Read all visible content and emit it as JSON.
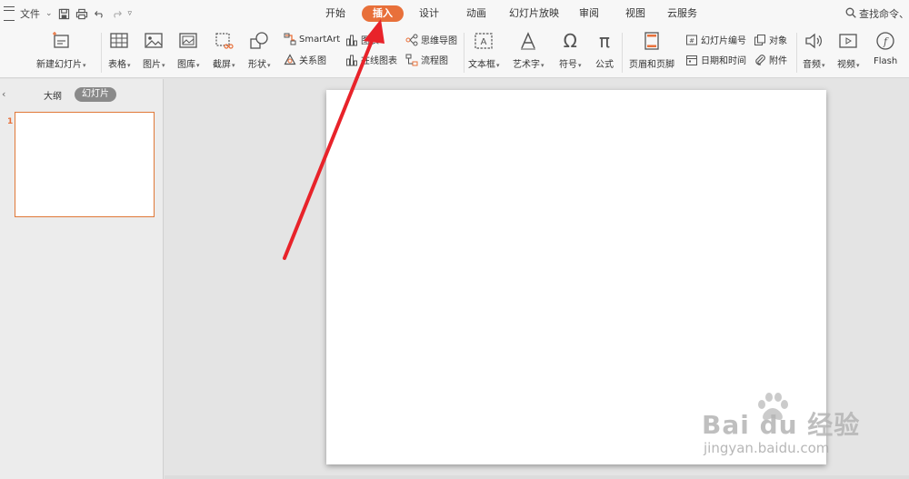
{
  "menubar": {
    "menu_label": "文件",
    "tabs": [
      {
        "label": "开始",
        "active": false
      },
      {
        "label": "插入",
        "active": true
      },
      {
        "label": "设计",
        "active": false
      },
      {
        "label": "动画",
        "active": false
      },
      {
        "label": "幻灯片放映",
        "active": false
      },
      {
        "label": "审阅",
        "active": false
      },
      {
        "label": "视图",
        "active": false
      },
      {
        "label": "云服务",
        "active": false
      }
    ],
    "search_label": "查找命令、"
  },
  "ribbon": {
    "new_slide": "新建幻灯片",
    "table": "表格",
    "picture": "图片",
    "gallery": "图库",
    "screenshot": "截屏",
    "shape": "形状",
    "smartart": "SmartArt",
    "chart": "图表",
    "relation": "关系图",
    "online_chart": "在线图表",
    "mindmap": "思维导图",
    "flowchart": "流程图",
    "textbox": "文本框",
    "wordart": "艺术字",
    "symbol": "符号",
    "formula": "公式",
    "header_footer": "页眉和页脚",
    "slide_number": "幻灯片编号",
    "date_time": "日期和时间",
    "object": "对象",
    "attachment": "附件",
    "audio": "音频",
    "video": "视频",
    "flash": "Flash"
  },
  "panel": {
    "tab_outline": "大纲",
    "tab_slides": "幻灯片",
    "slide_number": "1"
  },
  "watermark": {
    "brand": "Bai du 经验",
    "url": "jingyan.baidu.com"
  },
  "colors": {
    "accent": "#e8703a",
    "arrow": "#e8232a"
  }
}
